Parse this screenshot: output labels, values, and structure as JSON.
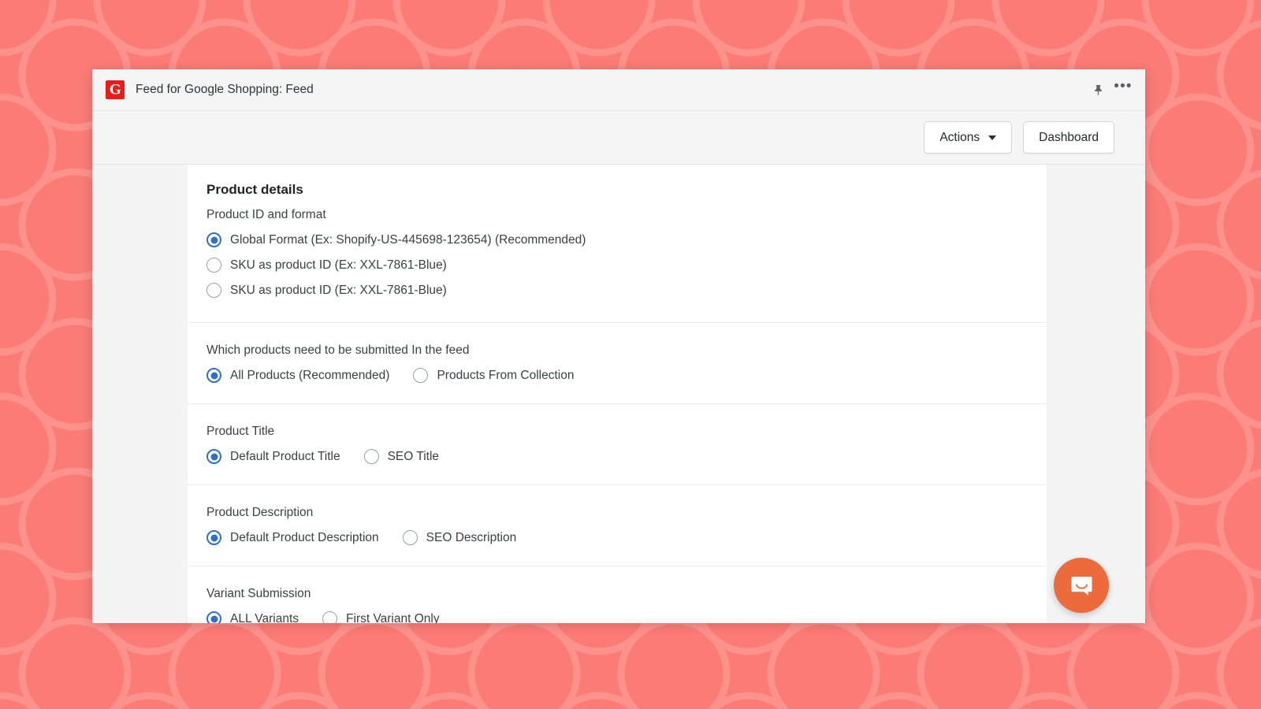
{
  "theme": {
    "backdrop_color": "#fb7b76",
    "backdrop_pattern_color": "#fd918c",
    "accent_radio_color": "#2f6fd0",
    "app_icon_color": "#ea1d1d",
    "chat_launcher_color": "#ec6a3c"
  },
  "window": {
    "title": "Feed for Google Shopping: Feed",
    "app_icon_letter": "G",
    "app_icon_name": "google-shopping-feed-icon",
    "pin_icon": "pin-icon",
    "overflow_icon": "•••"
  },
  "toolbar": {
    "actions_label": "Actions",
    "dashboard_label": "Dashboard"
  },
  "sections": [
    {
      "heading": "Product details",
      "label": "Product ID and format",
      "layout": "stack",
      "options": [
        {
          "label": "Global Format (Ex: Shopify-US-445698-123654) (Recommended)",
          "selected": true
        },
        {
          "label": "SKU as product ID (Ex: XXL-7861-Blue)",
          "selected": false
        },
        {
          "label": "SKU as product ID (Ex: XXL-7861-Blue)",
          "selected": false
        }
      ]
    },
    {
      "heading": null,
      "label": "Which products need to be submitted In the feed",
      "layout": "row",
      "options": [
        {
          "label": "All Products (Recommended)",
          "selected": true
        },
        {
          "label": "Products From Collection",
          "selected": false
        }
      ]
    },
    {
      "heading": null,
      "label": "Product Title",
      "layout": "row",
      "options": [
        {
          "label": "Default Product Title",
          "selected": true
        },
        {
          "label": "SEO Title",
          "selected": false
        }
      ]
    },
    {
      "heading": null,
      "label": "Product Description",
      "layout": "row",
      "options": [
        {
          "label": "Default Product Description",
          "selected": true
        },
        {
          "label": "SEO Description",
          "selected": false
        }
      ]
    },
    {
      "heading": null,
      "label": "Variant Submission",
      "layout": "row",
      "options": [
        {
          "label": "ALL Variants",
          "selected": true
        },
        {
          "label": "First Variant Only",
          "selected": false
        }
      ]
    }
  ],
  "chat": {
    "icon_name": "chat-bubble-smile-icon"
  }
}
